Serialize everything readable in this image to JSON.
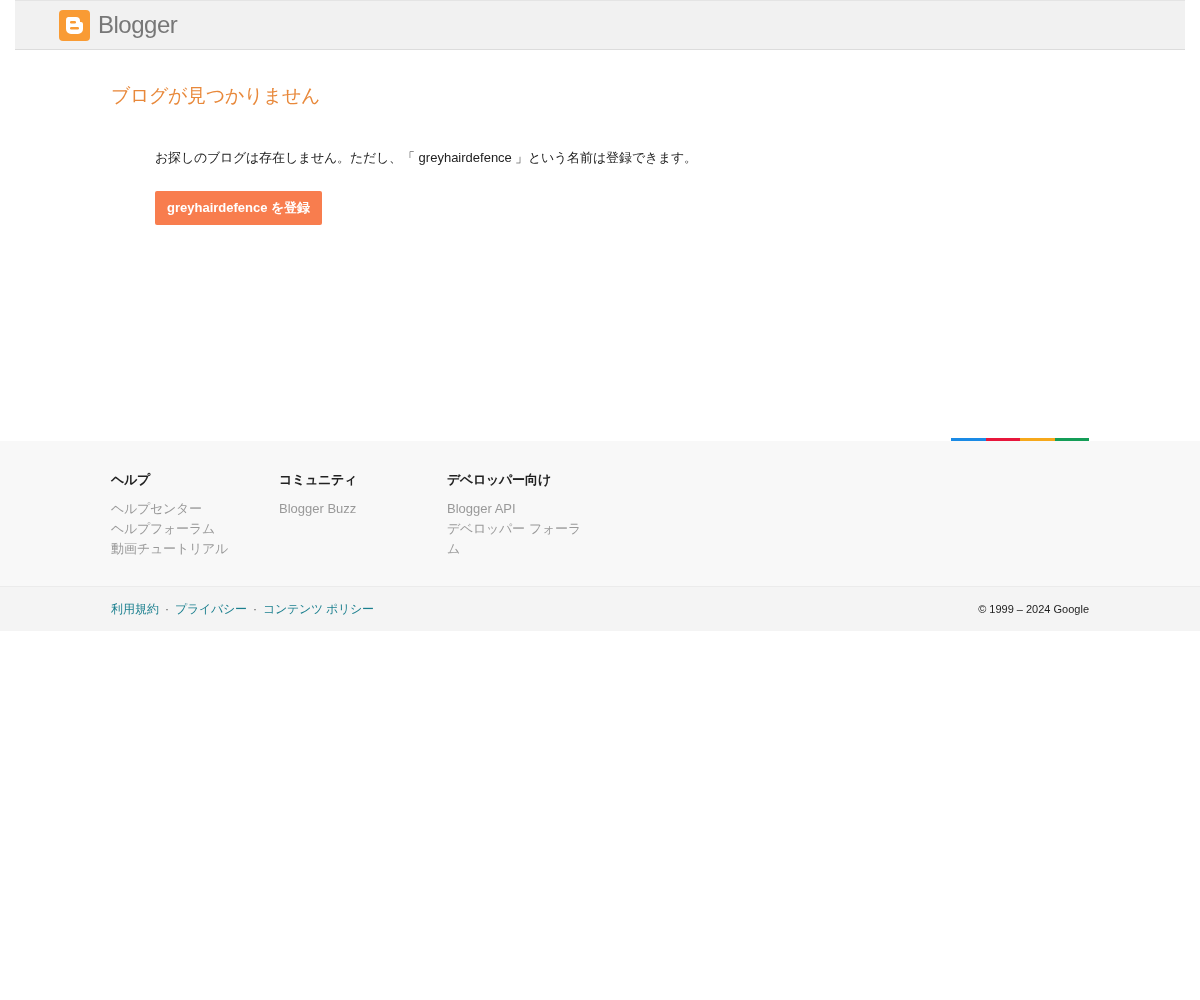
{
  "header": {
    "logo_text": "Blogger"
  },
  "main": {
    "title": "ブログが見つかりません",
    "message": "お探しのブログは存在しません。ただし、「 greyhairdefence 」という名前は登録できます。",
    "button": "greyhairdefence を登録"
  },
  "footer": {
    "columns": [
      {
        "heading": "ヘルプ",
        "links": [
          "ヘルプセンター",
          "ヘルプフォーラム",
          "動画チュートリアル"
        ]
      },
      {
        "heading": "コミュニティ",
        "links": [
          "Blogger Buzz"
        ]
      },
      {
        "heading": "デベロッパー向け",
        "links": [
          "Blogger API",
          "デベロッパー フォーラム"
        ]
      }
    ]
  },
  "bottom_bar": {
    "links": [
      "利用規約",
      "プライバシー",
      "コンテンツ ポリシー"
    ],
    "separator": "·",
    "copyright": "© 1999 – 2024 Google"
  }
}
